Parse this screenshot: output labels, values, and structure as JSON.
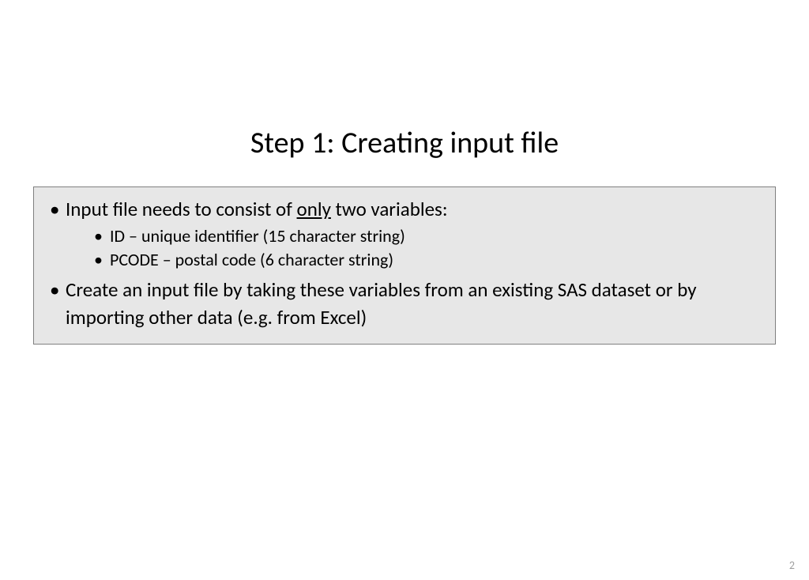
{
  "slide": {
    "title": "Step 1: Creating input file",
    "bullets": [
      {
        "prefix": "Input file needs to consist of ",
        "underlined": "only",
        "suffix": " two variables:",
        "sub": [
          "ID – unique identifier (15 character string)",
          "PCODE – postal code (6 character string)"
        ]
      },
      {
        "text": "Create an input file by taking these variables from an existing SAS dataset or by importing other data (e.g. from Excel)"
      }
    ],
    "page_number": "2"
  }
}
